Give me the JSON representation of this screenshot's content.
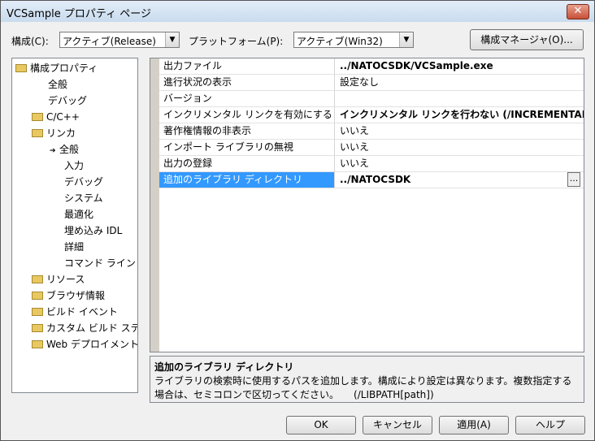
{
  "window": {
    "title": "VCSample プロパティ ページ",
    "close_glyph": "✕"
  },
  "config": {
    "label": "構成(C):",
    "value": "アクティブ(Release)"
  },
  "platform": {
    "label": "プラットフォーム(P):",
    "value": "アクティブ(Win32)"
  },
  "config_manager_label": "構成マネージャ(O)...",
  "tree": {
    "root": "構成プロパティ",
    "items": [
      {
        "label": "全般",
        "icon": ""
      },
      {
        "label": "デバッグ",
        "icon": ""
      },
      {
        "label": "C/C++",
        "icon": "folder-icon"
      },
      {
        "label": "リンカ",
        "icon": "folder-icon"
      },
      {
        "label": "全般",
        "icon": "arrow-icon"
      },
      {
        "label": "入力",
        "icon": ""
      },
      {
        "label": "デバッグ",
        "icon": ""
      },
      {
        "label": "システム",
        "icon": ""
      },
      {
        "label": "最適化",
        "icon": ""
      },
      {
        "label": "埋め込み IDL",
        "icon": ""
      },
      {
        "label": "詳細",
        "icon": ""
      },
      {
        "label": "コマンド ライン",
        "icon": ""
      },
      {
        "label": "リソース",
        "icon": "folder-icon"
      },
      {
        "label": "ブラウザ情報",
        "icon": "folder-icon"
      },
      {
        "label": "ビルド イベント",
        "icon": "folder-icon"
      },
      {
        "label": "カスタム ビルド ステップ",
        "icon": "folder-icon"
      },
      {
        "label": "Web デプロイメント",
        "icon": "folder-icon"
      }
    ]
  },
  "properties": [
    {
      "name": "出力ファイル",
      "value": "../NATOCSDK/VCSample.exe"
    },
    {
      "name": "進行状況の表示",
      "value": "設定なし"
    },
    {
      "name": "バージョン",
      "value": ""
    },
    {
      "name": "インクリメンタル リンクを有効にする",
      "value": "インクリメンタル リンクを行わない (/INCREMENTAL:NO)"
    },
    {
      "name": "著作権情報の非表示",
      "value": "いいえ"
    },
    {
      "name": "インポート ライブラリの無視",
      "value": "いいえ"
    },
    {
      "name": "出力の登録",
      "value": "いいえ"
    },
    {
      "name": "追加のライブラリ ディレクトリ",
      "value": "../NATOCSDK",
      "ellipsis": "..."
    }
  ],
  "description": {
    "title": "追加のライブラリ ディレクトリ",
    "text": "ライブラリの検索時に使用するパスを追加します。構成により設定は異なります。複数指定する場合は、セミコロンで区切ってください。　　(/LIBPATH[path])"
  },
  "buttons": {
    "ok": "OK",
    "cancel": "キャンセル",
    "apply": "適用(A)",
    "help": "ヘルプ"
  }
}
